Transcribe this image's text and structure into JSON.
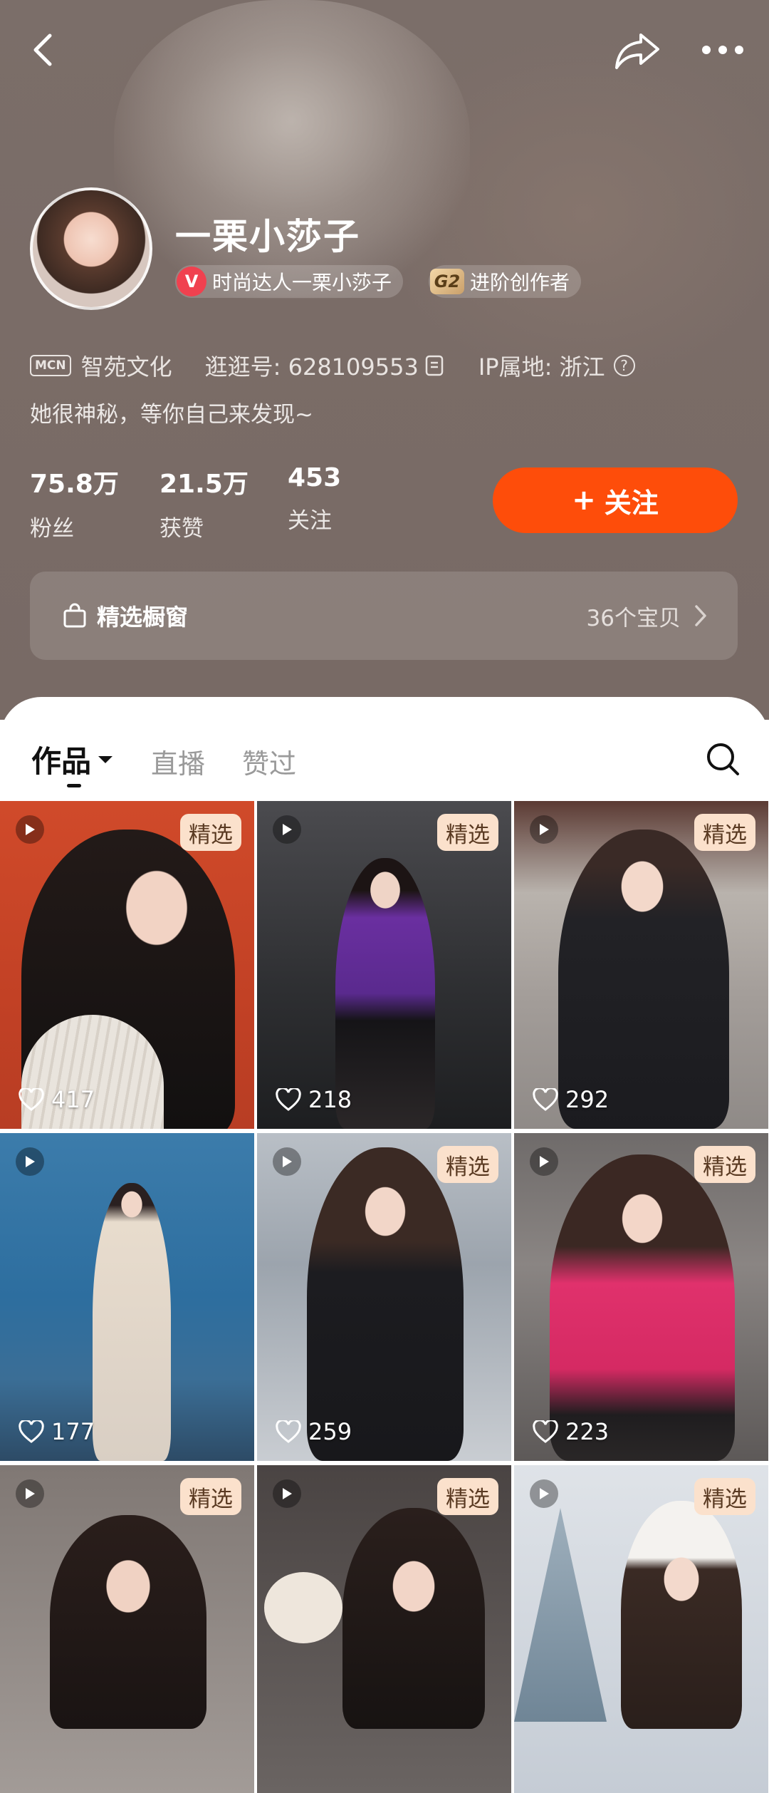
{
  "header": {
    "back_icon": "chevron-left-icon",
    "share_icon": "share-arrow-icon",
    "more_icon": "ellipsis-icon"
  },
  "profile": {
    "name": "一栗小莎子",
    "badge_verified": "时尚达人一栗小莎子",
    "badge_level_icon": "G2",
    "badge_level": "进阶创作者",
    "mcn_tag": "MCN",
    "mcn_name": "智苑文化",
    "account_id": "逛逛号: 628109553",
    "ip_location": "IP属地: 浙江",
    "help_icon": "?",
    "bio": "她很神秘，等你自己来发现~"
  },
  "stats": [
    {
      "value": "75.8万",
      "label": "粉丝"
    },
    {
      "value": "21.5万",
      "label": "获赞"
    },
    {
      "value": "453",
      "label": "关注"
    }
  ],
  "follow_button": {
    "plus": "+",
    "label": "关注",
    "color": "#fe4d0a"
  },
  "shop": {
    "title": "精选橱窗",
    "count": "36个宝贝"
  },
  "tabs": [
    {
      "label": "作品",
      "active": true
    },
    {
      "label": "直播",
      "active": false
    },
    {
      "label": "赞过",
      "active": false
    }
  ],
  "grid": {
    "tag_label": "精选",
    "items": [
      {
        "likes": "417",
        "featured": true
      },
      {
        "likes": "218",
        "featured": true
      },
      {
        "likes": "292",
        "featured": true
      },
      {
        "likes": "177",
        "featured": false
      },
      {
        "likes": "259",
        "featured": true
      },
      {
        "likes": "223",
        "featured": true
      },
      {
        "likes": "",
        "featured": true
      },
      {
        "likes": "",
        "featured": true
      },
      {
        "likes": "",
        "featured": true
      }
    ]
  }
}
